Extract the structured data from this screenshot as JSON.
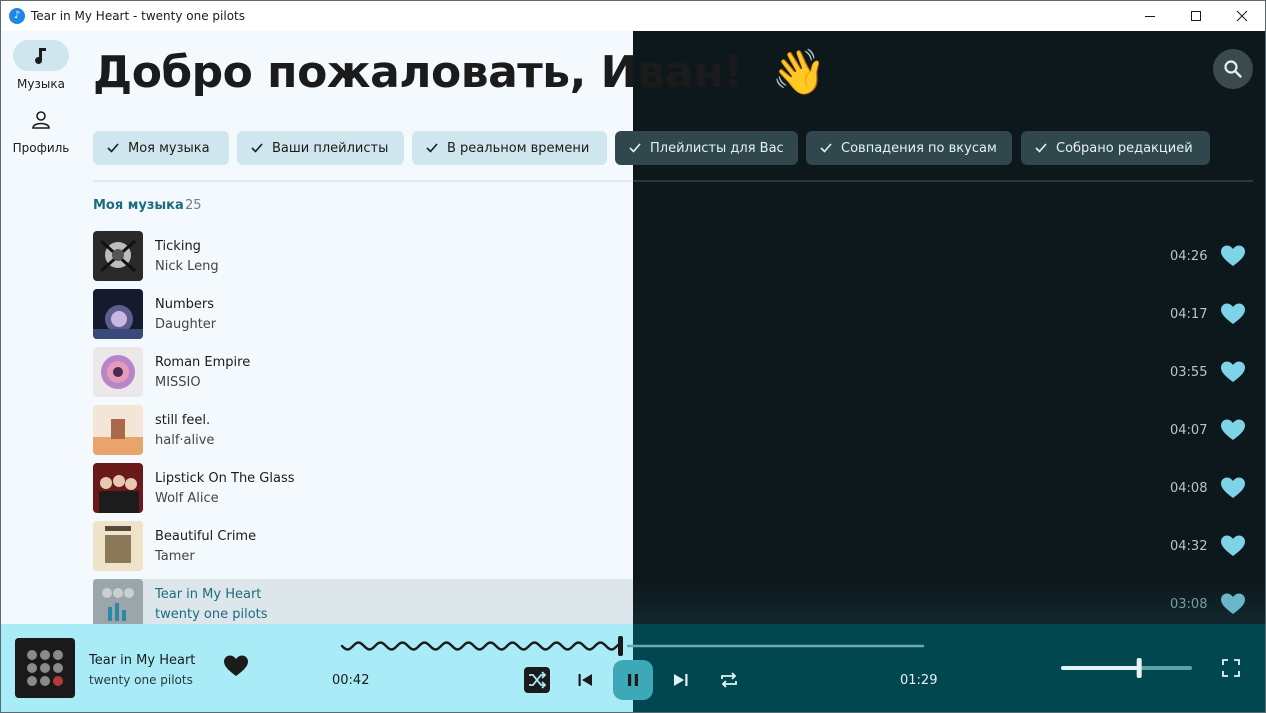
{
  "window": {
    "title": "Tear in My Heart - twenty one pilots",
    "app_icon": "music-note-icon"
  },
  "nav": {
    "items": [
      {
        "label": "Музыка",
        "icon": "music-note-icon",
        "active": true
      },
      {
        "label": "Профиль",
        "icon": "person-icon",
        "active": false
      }
    ]
  },
  "header": {
    "greeting": "Добро пожаловать, Иван!",
    "emoji": "👋",
    "search_icon": "search-icon"
  },
  "filters": [
    {
      "label": "Моя музыка",
      "checked": true
    },
    {
      "label": "Ваши плейлисты",
      "checked": true
    },
    {
      "label": "В реальном времени",
      "checked": true
    },
    {
      "label": "Плейлисты для Вас",
      "checked": true
    },
    {
      "label": "Совпадения по вкусам",
      "checked": true
    },
    {
      "label": "Собрано редакцией",
      "checked": true
    }
  ],
  "section": {
    "title": "Моя музыка",
    "count": "25"
  },
  "tracks": [
    {
      "title": "Ticking",
      "artist": "Nick Leng",
      "duration": "04:26",
      "liked": true
    },
    {
      "title": "Numbers",
      "artist": "Daughter",
      "duration": "04:17",
      "liked": true
    },
    {
      "title": "Roman Empire",
      "artist": "MISSIO",
      "duration": "03:55",
      "liked": true
    },
    {
      "title": "still feel.",
      "artist": "half·alive",
      "duration": "04:07",
      "liked": true
    },
    {
      "title": "Lipstick On The Glass",
      "artist": "Wolf Alice",
      "duration": "04:08",
      "liked": true
    },
    {
      "title": "Beautiful Crime",
      "artist": "Tamer",
      "duration": "04:32",
      "liked": true
    },
    {
      "title": "Tear in My Heart",
      "artist": "twenty one pilots",
      "duration": "03:08",
      "liked": true,
      "playing": true
    }
  ],
  "player": {
    "title": "Tear in My Heart",
    "artist": "twenty one pilots",
    "liked": true,
    "elapsed": "00:42",
    "remaining": "01:29",
    "progress_fraction": 0.48,
    "volume_fraction": 0.6,
    "shuffle_on": true,
    "playing": true
  },
  "colors": {
    "accent": "#1d6b80",
    "heart": "#7fd3e6",
    "player_light": "#a9ecf8",
    "player_dark": "#00474f",
    "pause_button": "#3fa8b8"
  }
}
